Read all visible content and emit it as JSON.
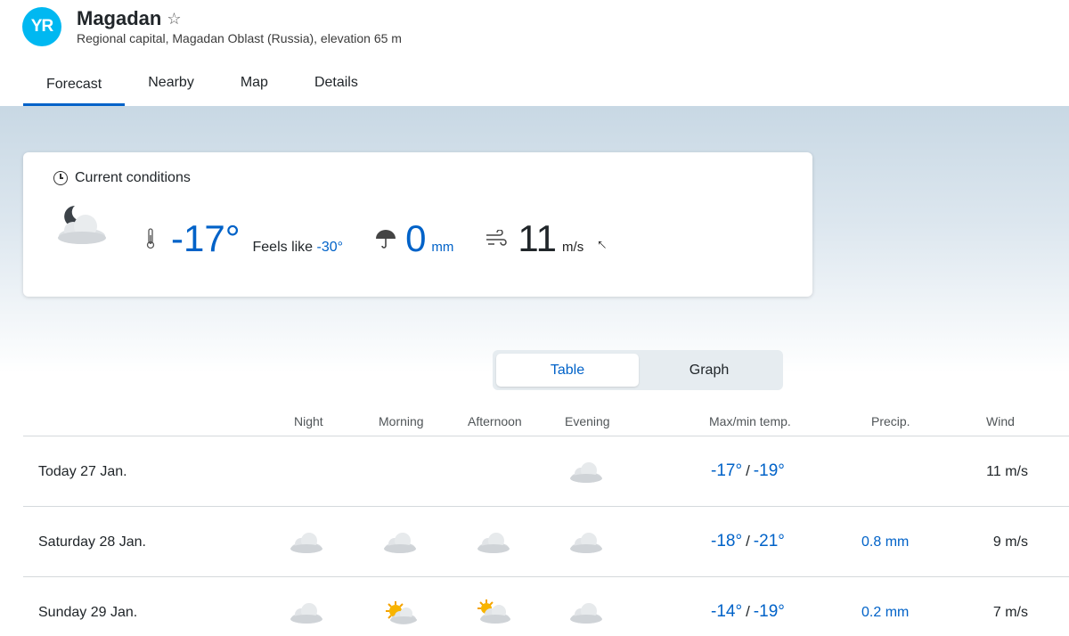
{
  "header": {
    "logo_text": "YR",
    "title": "Magadan",
    "subtitle": "Regional capital, Magadan Oblast (Russia), elevation 65 m"
  },
  "tabs": [
    "Forecast",
    "Nearby",
    "Map",
    "Details"
  ],
  "current": {
    "heading": "Current conditions",
    "symbol": "partly-cloudy-night-icon",
    "temperature": "-17°",
    "feels_label": "Feels like ",
    "feels_value": "-30°",
    "precip_value": "0",
    "precip_unit": "mm",
    "wind_value": "11",
    "wind_unit": "m/s",
    "wind_arrow": "→"
  },
  "toggle": {
    "table": "Table",
    "graph": "Graph"
  },
  "table": {
    "headers": {
      "night": "Night",
      "morning": "Morning",
      "afternoon": "Afternoon",
      "evening": "Evening",
      "maxmin": "Max/min temp.",
      "precip": "Precip.",
      "wind": "Wind"
    },
    "rows": [
      {
        "day": "Today 27 Jan.",
        "symbols": [
          "",
          "",
          "",
          "cloud"
        ],
        "max": "-17°",
        "sep": "/",
        "min": "-19°",
        "precip": "",
        "wind": "11 m/s"
      },
      {
        "day": "Saturday 28 Jan.",
        "symbols": [
          "cloud",
          "cloud",
          "cloud",
          "cloud"
        ],
        "max": "-18°",
        "sep": "/",
        "min": "-21°",
        "precip": "0.8 mm",
        "wind": "9 m/s"
      },
      {
        "day": "Sunday 29 Jan.",
        "symbols": [
          "cloud",
          "sun-cloud",
          "sun-cloud-small",
          "cloud"
        ],
        "max": "-14°",
        "sep": "/",
        "min": "-19°",
        "precip": "0.2 mm",
        "wind": "7 m/s"
      }
    ]
  },
  "colors": {
    "accent": "#0062c8",
    "logo": "#00b8f1"
  }
}
